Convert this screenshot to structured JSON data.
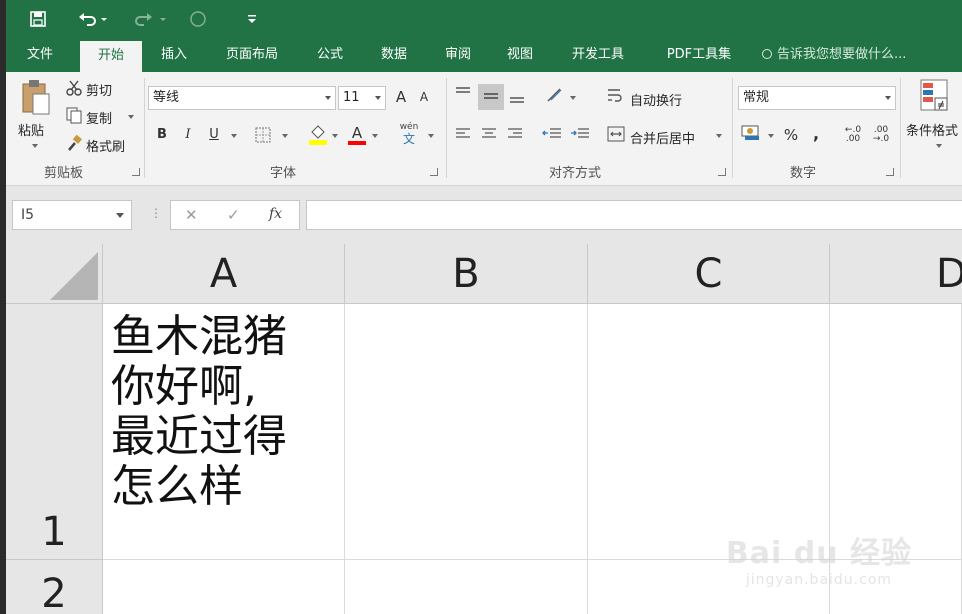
{
  "qat": {
    "save_icon": "save-icon",
    "undo_icon": "undo-icon",
    "redo_icon": "redo-icon",
    "touch_icon": "touch-mode-icon",
    "customize_icon": "customize-qat-icon"
  },
  "tabs": [
    {
      "label": "文件"
    },
    {
      "label": "开始"
    },
    {
      "label": "插入"
    },
    {
      "label": "页面布局"
    },
    {
      "label": "公式"
    },
    {
      "label": "数据"
    },
    {
      "label": "审阅"
    },
    {
      "label": "视图"
    },
    {
      "label": "开发工具"
    },
    {
      "label": "PDF工具集"
    }
  ],
  "active_tab": "开始",
  "tell_me": "告诉我您想要做什么...",
  "clipboard": {
    "paste": "粘贴",
    "cut": "剪切",
    "copy": "复制",
    "format_painter": "格式刷",
    "group_label": "剪贴板"
  },
  "font": {
    "name": "等线",
    "size": "11",
    "grow": "A",
    "shrink": "A",
    "bold": "B",
    "italic": "I",
    "underline": "U",
    "font_color_letter": "A",
    "phonetic_top": "wén",
    "phonetic_bottom": "文",
    "group_label": "字体"
  },
  "alignment": {
    "wrap_text": "自动换行",
    "merge_center": "合并后居中",
    "group_label": "对齐方式"
  },
  "number": {
    "format": "常规",
    "percent": "%",
    "comma": ",",
    "inc_decimal": "←.0 .00",
    "dec_decimal": ".00 →.0",
    "group_label": "数字"
  },
  "styles": {
    "conditional_format": "条件格式"
  },
  "formula_bar": {
    "name_box": "I5",
    "cancel": "✕",
    "enter": "✓",
    "fx": "fx",
    "content": ""
  },
  "grid": {
    "columns": [
      "A",
      "B",
      "C",
      "D"
    ],
    "rows": [
      "1",
      "2"
    ],
    "cells": {
      "A1": "鱼木混猪\n你好啊,\n最近过得\n怎么样"
    }
  },
  "watermark": {
    "main": "Bai du 经验",
    "sub": "jingyan.baidu.com"
  },
  "colors": {
    "ribbon_green": "#217346",
    "ribbon_bg": "#f3f3f3",
    "header_bg": "#e6e6e6",
    "highlight_yellow": "#ffff00",
    "font_red": "#ff0000"
  }
}
